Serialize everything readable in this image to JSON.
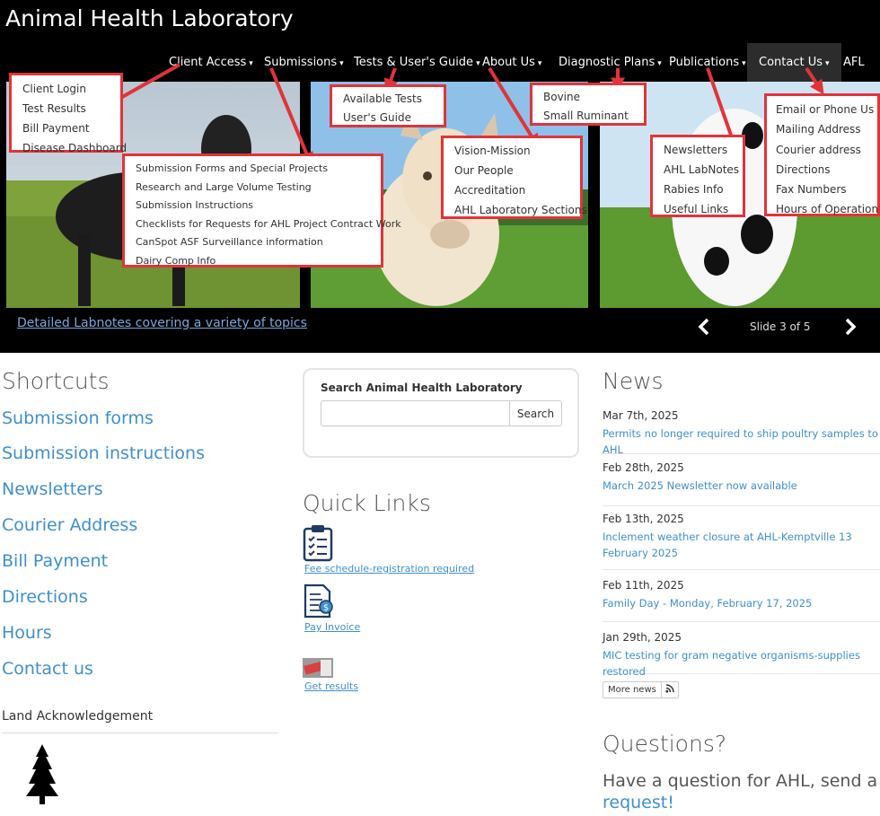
{
  "site": {
    "title": "Animal Health Laboratory"
  },
  "nav": {
    "client_access": "Client Access",
    "submissions": "Submissions",
    "tests_guide": "Tests & User's Guide",
    "about_us": "About Us",
    "diagnostic_plans": "Diagnostic Plans",
    "publications": "Publications",
    "contact_us": "Contact Us",
    "afl": "AFL",
    "caret": "▾"
  },
  "dropdowns": {
    "client_access": [
      "Client Login",
      "Test Results",
      "Bill Payment",
      "Disease Dashboard"
    ],
    "submissions": [
      "Submission Forms and Special Projects",
      "Research and Large Volume Testing",
      "Submission Instructions",
      "Checklists for Requests for AHL Project Contract Work",
      "CanSpot ASF Surveillance information",
      "Dairy Comp Info"
    ],
    "tests": [
      "Available Tests",
      "User's Guide"
    ],
    "about": [
      "Vision-Mission",
      "Our People",
      "Accreditation",
      "AHL Laboratory Sections"
    ],
    "diagnostic": [
      "Bovine",
      "Small Ruminant"
    ],
    "publications": [
      "Newsletters",
      "AHL LabNotes",
      "Rabies Info",
      "Useful Links"
    ],
    "contact": [
      "Email or Phone Us",
      "Mailing Address",
      "Courier address",
      "Directions",
      "Fax Numbers",
      "Hours of Operation"
    ]
  },
  "slider": {
    "caption": "Detailed Labnotes covering a variety of topics",
    "counter": "Slide 3 of 5"
  },
  "shortcuts": {
    "title": "Shortcuts",
    "links": [
      "Submission forms",
      "Submission instructions",
      "Newsletters",
      "Courier Address",
      "Bill Payment",
      "Directions",
      "Hours",
      "Contact us"
    ]
  },
  "land": {
    "title": "Land Acknowledgement"
  },
  "search": {
    "label": "Search Animal Health Laboratory",
    "placeholder": "",
    "button": "Search"
  },
  "quick_links": {
    "title": "Quick Links",
    "items": [
      {
        "label": "Fee schedule-registration required",
        "icon": "clipboard-icon"
      },
      {
        "label": "Pay Invoice",
        "icon": "invoice-icon"
      },
      {
        "label": "Get results",
        "icon": "results-icon"
      }
    ]
  },
  "news": {
    "title": "News",
    "items": [
      {
        "date": "Mar 7th, 2025",
        "headline": "Permits no longer required to ship poultry samples to AHL"
      },
      {
        "date": "Feb 28th, 2025",
        "headline": "March 2025 Newsletter now available"
      },
      {
        "date": "Feb 13th, 2025",
        "headline": "Inclement weather closure at AHL-Kemptville 13 February 2025"
      },
      {
        "date": "Feb 11th, 2025",
        "headline": "Family Day - Monday, February 17, 2025"
      },
      {
        "date": "Jan 29th, 2025",
        "headline": "MIC testing for gram negative organisms-supplies restored"
      }
    ],
    "more": "More news"
  },
  "questions": {
    "title": "Questions?",
    "text": "Have a question for AHL, send a",
    "link": "request!"
  },
  "colors": {
    "accent": "#3f8fcd",
    "annotation": "#e0343a",
    "header_bg": "#000000"
  }
}
